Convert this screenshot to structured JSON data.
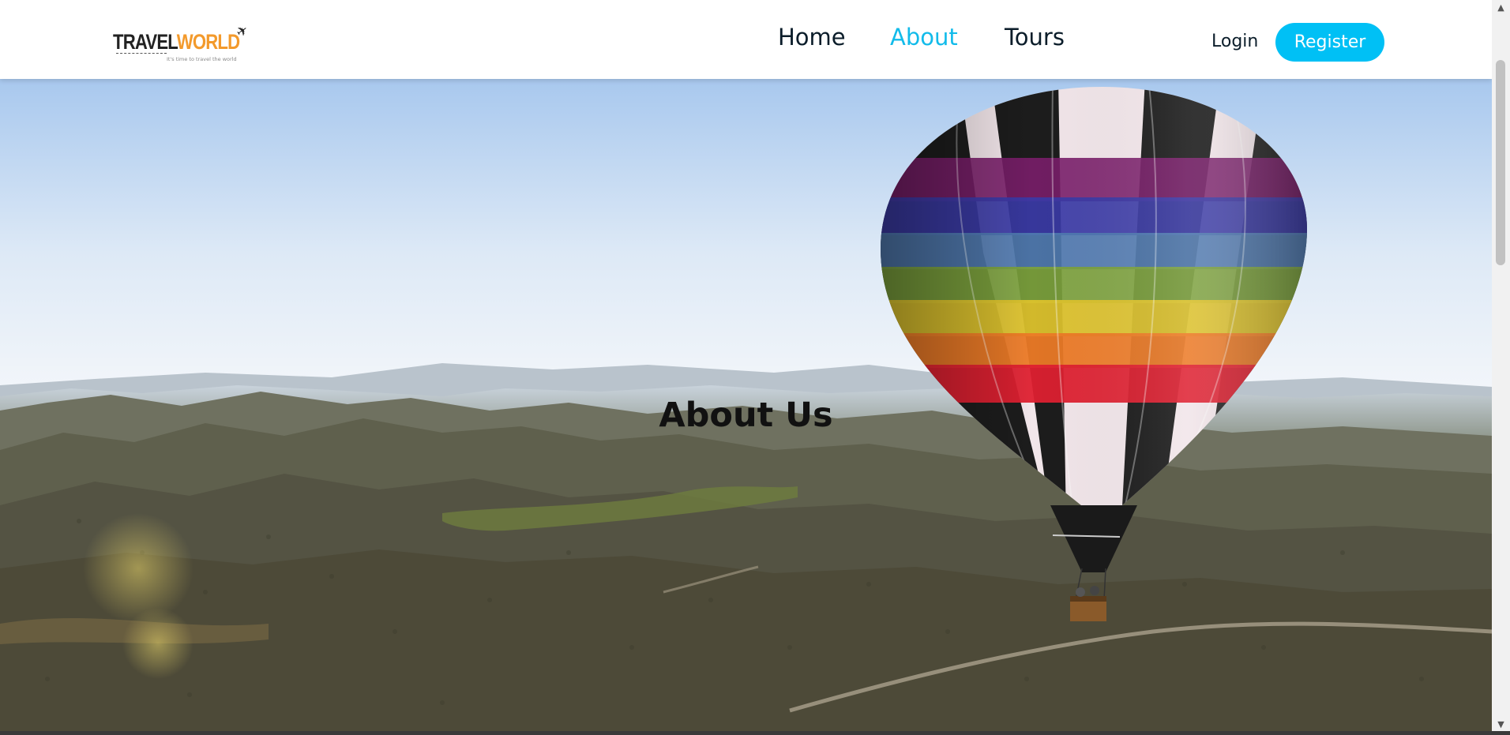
{
  "brand": {
    "logo_text_1": "TRAVEL",
    "logo_text_2": "WORLD",
    "tagline": "It's time to travel the world"
  },
  "nav": {
    "items": [
      {
        "label": "Home",
        "active": false
      },
      {
        "label": "About",
        "active": true
      },
      {
        "label": "Tours",
        "active": false
      }
    ],
    "login_label": "Login",
    "register_label": "Register"
  },
  "hero": {
    "title": "About Us"
  },
  "colors": {
    "accent": "#00c0f5",
    "active_link": "#12bbea",
    "logo_orange": "#f39a2c"
  },
  "icons": [
    "airplane-icon",
    "scroll-up-arrow-icon",
    "scroll-down-arrow-icon"
  ]
}
